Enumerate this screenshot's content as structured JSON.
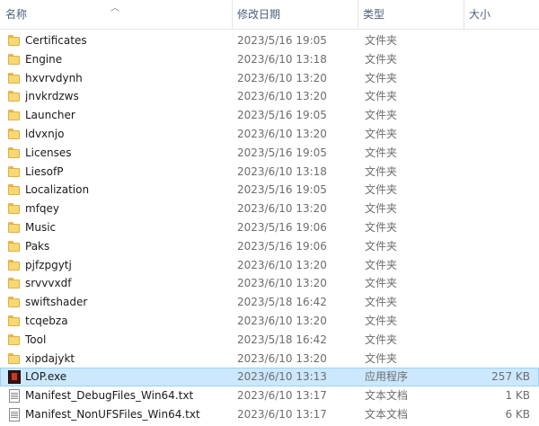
{
  "columns": {
    "name": "名称",
    "date": "修改日期",
    "type": "类型",
    "size": "大小"
  },
  "colors": {
    "selected_bg": "#cce8ff",
    "selected_border": "#99d1ff",
    "header_text": "#4c607a"
  },
  "files": [
    {
      "name": "Certificates",
      "date": "2023/5/16 19:05",
      "type": "文件夹",
      "size": "",
      "icon": "folder-icon"
    },
    {
      "name": "Engine",
      "date": "2023/6/10 13:18",
      "type": "文件夹",
      "size": "",
      "icon": "folder-icon"
    },
    {
      "name": "hxvrvdynh",
      "date": "2023/6/10 13:20",
      "type": "文件夹",
      "size": "",
      "icon": "folder-icon"
    },
    {
      "name": "jnvkrdzws",
      "date": "2023/6/10 13:20",
      "type": "文件夹",
      "size": "",
      "icon": "folder-icon"
    },
    {
      "name": "Launcher",
      "date": "2023/5/16 19:05",
      "type": "文件夹",
      "size": "",
      "icon": "folder-icon"
    },
    {
      "name": "ldvxnjo",
      "date": "2023/6/10 13:20",
      "type": "文件夹",
      "size": "",
      "icon": "folder-icon"
    },
    {
      "name": "Licenses",
      "date": "2023/5/16 19:05",
      "type": "文件夹",
      "size": "",
      "icon": "folder-icon"
    },
    {
      "name": "LiesofP",
      "date": "2023/6/10 13:18",
      "type": "文件夹",
      "size": "",
      "icon": "folder-icon"
    },
    {
      "name": "Localization",
      "date": "2023/5/16 19:05",
      "type": "文件夹",
      "size": "",
      "icon": "folder-icon"
    },
    {
      "name": "mfqey",
      "date": "2023/6/10 13:20",
      "type": "文件夹",
      "size": "",
      "icon": "folder-icon"
    },
    {
      "name": "Music",
      "date": "2023/5/16 19:06",
      "type": "文件夹",
      "size": "",
      "icon": "folder-icon"
    },
    {
      "name": "Paks",
      "date": "2023/5/16 19:06",
      "type": "文件夹",
      "size": "",
      "icon": "folder-icon"
    },
    {
      "name": "pjfzpgytj",
      "date": "2023/6/10 13:20",
      "type": "文件夹",
      "size": "",
      "icon": "folder-icon"
    },
    {
      "name": "srvvvxdf",
      "date": "2023/6/10 13:20",
      "type": "文件夹",
      "size": "",
      "icon": "folder-icon"
    },
    {
      "name": "swiftshader",
      "date": "2023/5/18 16:42",
      "type": "文件夹",
      "size": "",
      "icon": "folder-icon"
    },
    {
      "name": "tcqebza",
      "date": "2023/6/10 13:20",
      "type": "文件夹",
      "size": "",
      "icon": "folder-icon"
    },
    {
      "name": "Tool",
      "date": "2023/5/18 16:42",
      "type": "文件夹",
      "size": "",
      "icon": "folder-icon"
    },
    {
      "name": "xipdajykt",
      "date": "2023/6/10 13:20",
      "type": "文件夹",
      "size": "",
      "icon": "folder-icon"
    },
    {
      "name": "LOP.exe",
      "date": "2023/6/10 13:13",
      "type": "应用程序",
      "size": "257 KB",
      "icon": "exe-icon",
      "selected": true
    },
    {
      "name": "Manifest_DebugFiles_Win64.txt",
      "date": "2023/6/10 13:17",
      "type": "文本文档",
      "size": "1 KB",
      "icon": "txt-icon"
    },
    {
      "name": "Manifest_NonUFSFiles_Win64.txt",
      "date": "2023/6/10 13:17",
      "type": "文本文档",
      "size": "6 KB",
      "icon": "txt-icon"
    }
  ]
}
